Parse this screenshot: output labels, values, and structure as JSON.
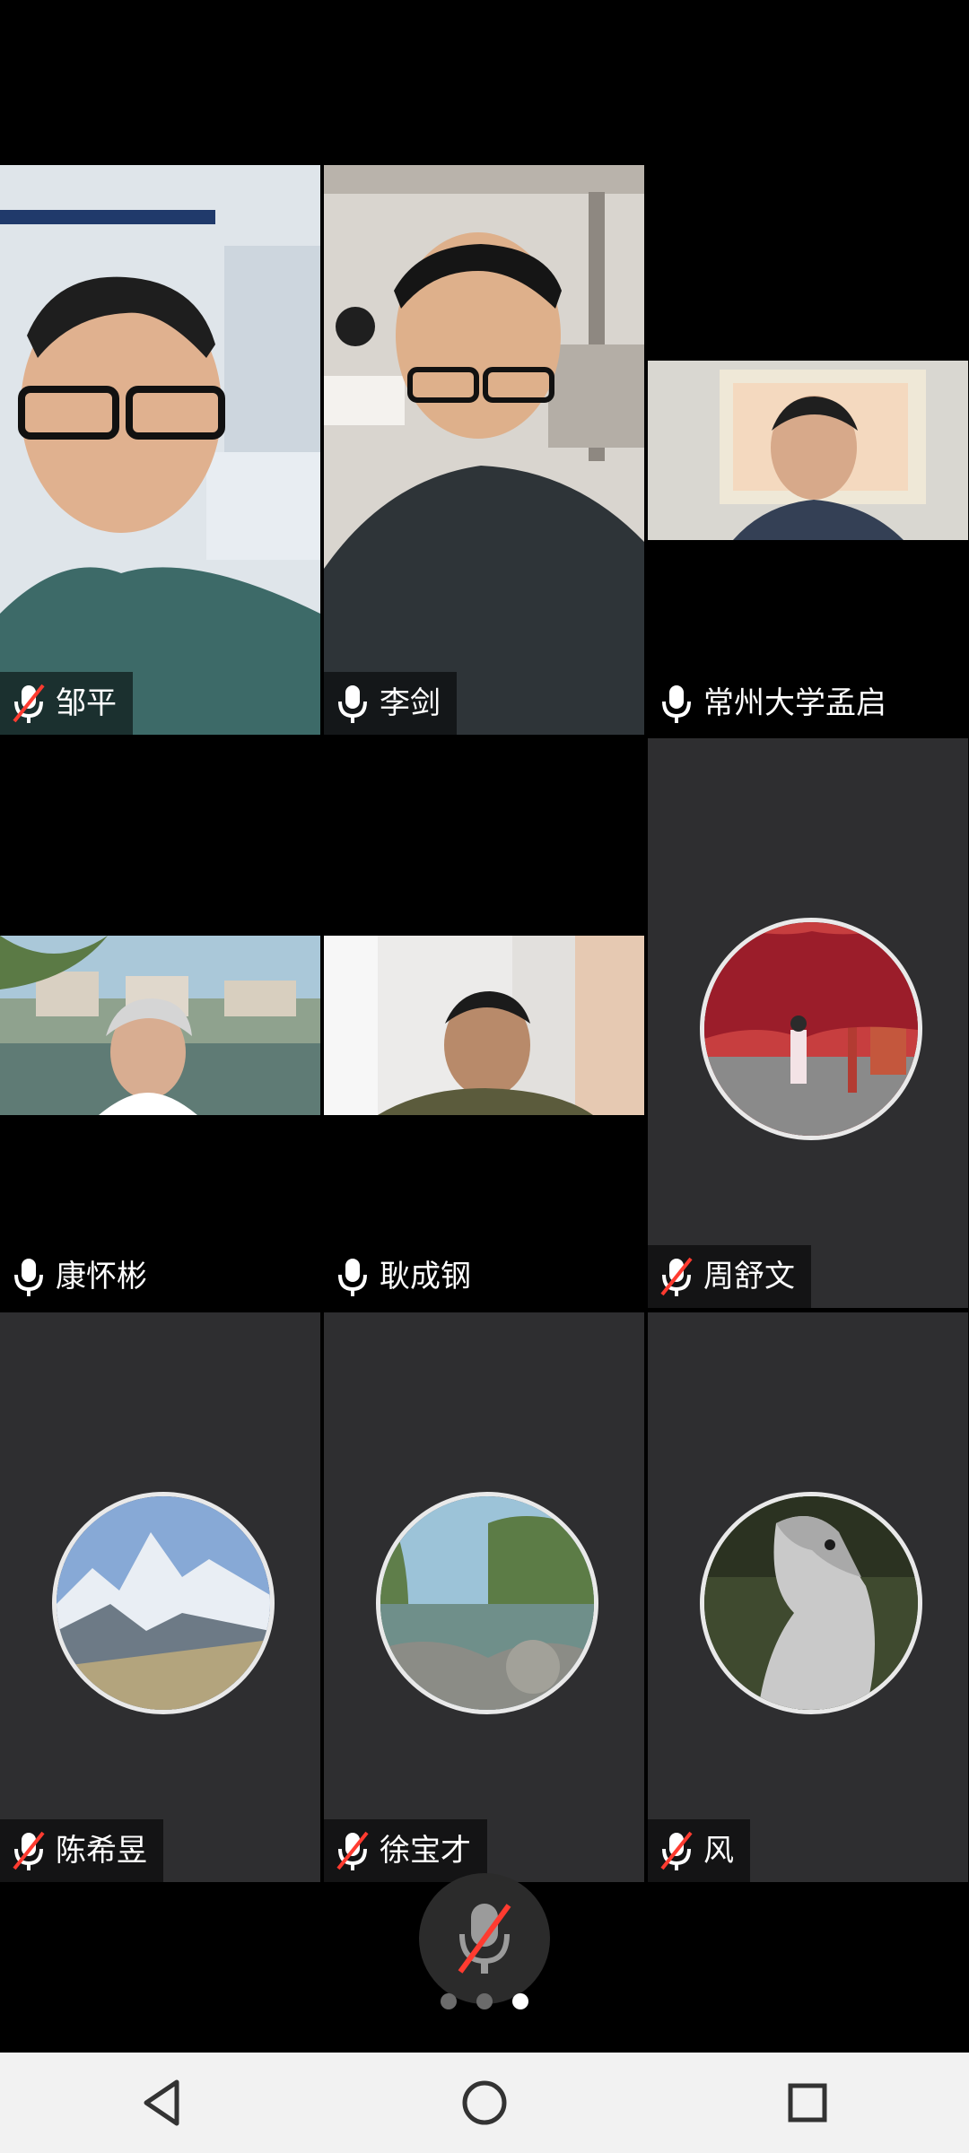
{
  "participants": [
    {
      "name": "邹平",
      "muted": true,
      "video": "on"
    },
    {
      "name": "李剑",
      "muted": false,
      "video": "on"
    },
    {
      "name": "常州大学孟启",
      "muted": false,
      "video": "on"
    },
    {
      "name": "康怀彬",
      "muted": false,
      "video": "on"
    },
    {
      "name": "耿成钢",
      "muted": false,
      "video": "on"
    },
    {
      "name": "周舒文",
      "muted": true,
      "video": "avatar"
    },
    {
      "name": "陈希昱",
      "muted": true,
      "video": "avatar"
    },
    {
      "name": "徐宝才",
      "muted": true,
      "video": "avatar"
    },
    {
      "name": "风",
      "muted": true,
      "video": "avatar"
    }
  ],
  "controls": {
    "mute_button_icon": "mic-muted-icon",
    "pager": {
      "pages": 3,
      "active": 3
    }
  },
  "system_nav": {
    "back_icon": "back-triangle-icon",
    "home_icon": "home-circle-icon",
    "recent_icon": "recent-square-icon"
  }
}
